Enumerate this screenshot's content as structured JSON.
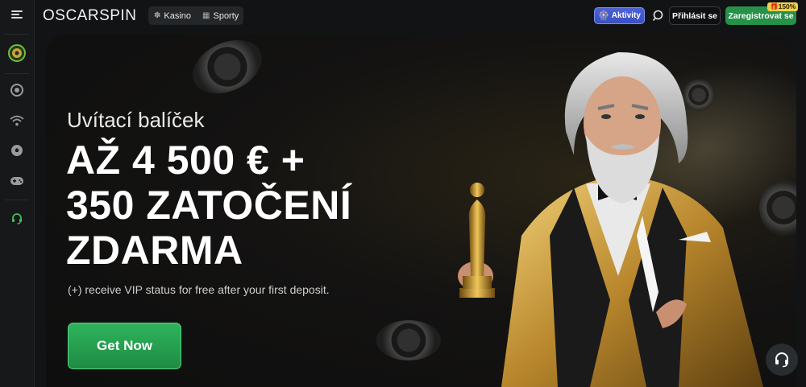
{
  "header": {
    "logo_text": "OSCARSPIN",
    "tabs": [
      {
        "label": "Kasino",
        "icon": "casino-chip-icon"
      },
      {
        "label": "Sporty",
        "icon": "sports-icon"
      }
    ],
    "aktivity_label": "Aktivity",
    "login_label": "Přihlásit se",
    "register_label": "Zaregistrovat se",
    "register_badge": "150%"
  },
  "sidebar": {
    "items": [
      {
        "icon": "menu-icon"
      },
      {
        "icon": "wheel-of-fortune-icon"
      },
      {
        "icon": "casino-chip-icon"
      },
      {
        "icon": "live-signal-icon"
      },
      {
        "icon": "soccer-ball-icon"
      },
      {
        "icon": "gamepad-icon"
      },
      {
        "icon": "support-agent-icon"
      }
    ]
  },
  "hero": {
    "subtitle": "Uvítací balíček",
    "title_line1": "AŽ 4 500 € +",
    "title_line2": "350 ZATOČENÍ",
    "title_line3": "ZDARMA",
    "note": "(+) receive VIP status for free after your first deposit.",
    "cta_label": "Get Now"
  },
  "colors": {
    "accent_green": "#27914a",
    "aktivity_blue": "#3a4ebf",
    "gold": "#d6b14a"
  }
}
